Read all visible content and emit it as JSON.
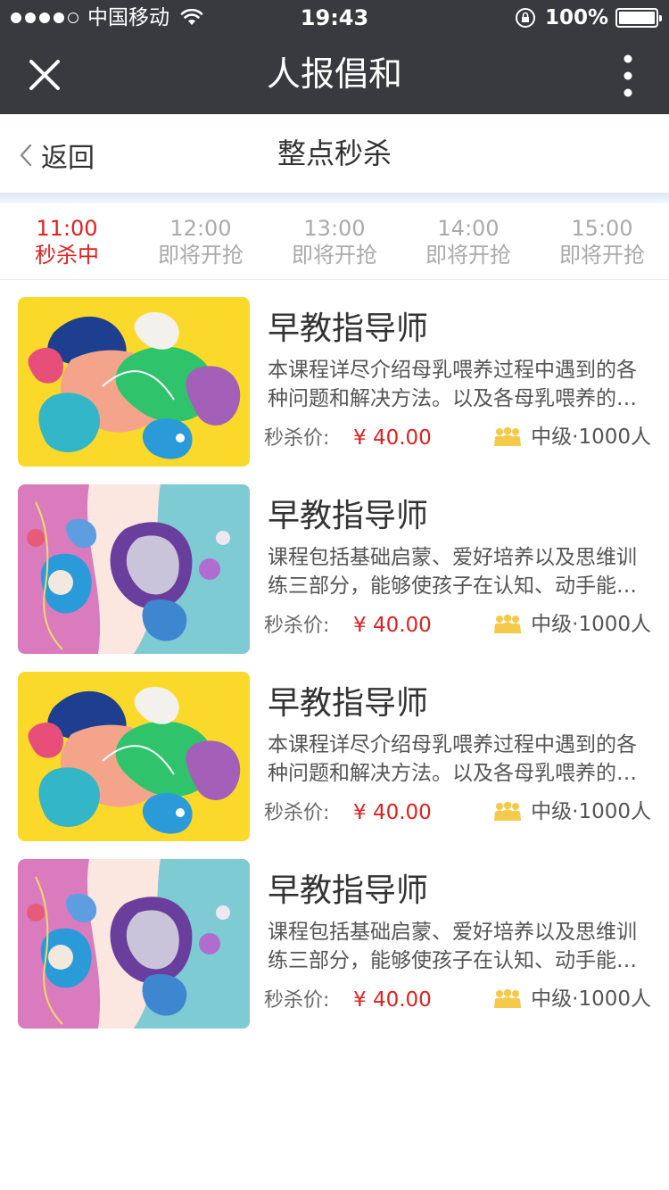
{
  "status_bar": {
    "carrier": "中国移动",
    "time": "19:43",
    "battery": "100%",
    "battery_level": 1.0
  },
  "nav": {
    "title": "人报倡和",
    "close_icon": "close-icon",
    "more_icon": "more-vertical-icon"
  },
  "subheader": {
    "back_label": "返回",
    "title": "整点秒杀"
  },
  "tabs": [
    {
      "time": "11:00",
      "status": "秒杀中",
      "active": true
    },
    {
      "time": "12:00",
      "status": "即将开抢",
      "active": false
    },
    {
      "time": "13:00",
      "status": "即将开抢",
      "active": false
    },
    {
      "time": "14:00",
      "status": "即将开抢",
      "active": false
    },
    {
      "time": "15:00",
      "status": "即将开抢",
      "active": false
    }
  ],
  "items": [
    {
      "title": "早教指导师",
      "desc": "本课程详尽介绍母乳喂养过程中遇到的各种问题和解决方法。以及各母乳喂养的注意事项",
      "price_label": "秒杀价:",
      "price": "¥ 40.00",
      "level": "中级·1000人",
      "thumb": "yellow"
    },
    {
      "title": "早教指导师",
      "desc": "课程包括基础启蒙、爱好培养以及思维训练三部分，能够使孩子在认知、动手能力方面得到提升",
      "price_label": "秒杀价:",
      "price": "¥ 40.00",
      "level": "中级·1000人",
      "thumb": "pink"
    },
    {
      "title": "早教指导师",
      "desc": "本课程详尽介绍母乳喂养过程中遇到的各种问题和解决方法。以及各母乳喂养的注意事项",
      "price_label": "秒杀价:",
      "price": "¥ 40.00",
      "level": "中级·1000人",
      "thumb": "yellow"
    },
    {
      "title": "早教指导师",
      "desc": "课程包括基础启蒙、爱好培养以及思维训练三部分，能够使孩子在认知、动手能力方面得到提升",
      "price_label": "秒杀价:",
      "price": "¥ 40.00",
      "level": "中级·1000人",
      "thumb": "pink"
    }
  ],
  "colors": {
    "header_bg": "#393a3f",
    "accent_red": "#e02020",
    "people_icon": "#f5c94a"
  }
}
